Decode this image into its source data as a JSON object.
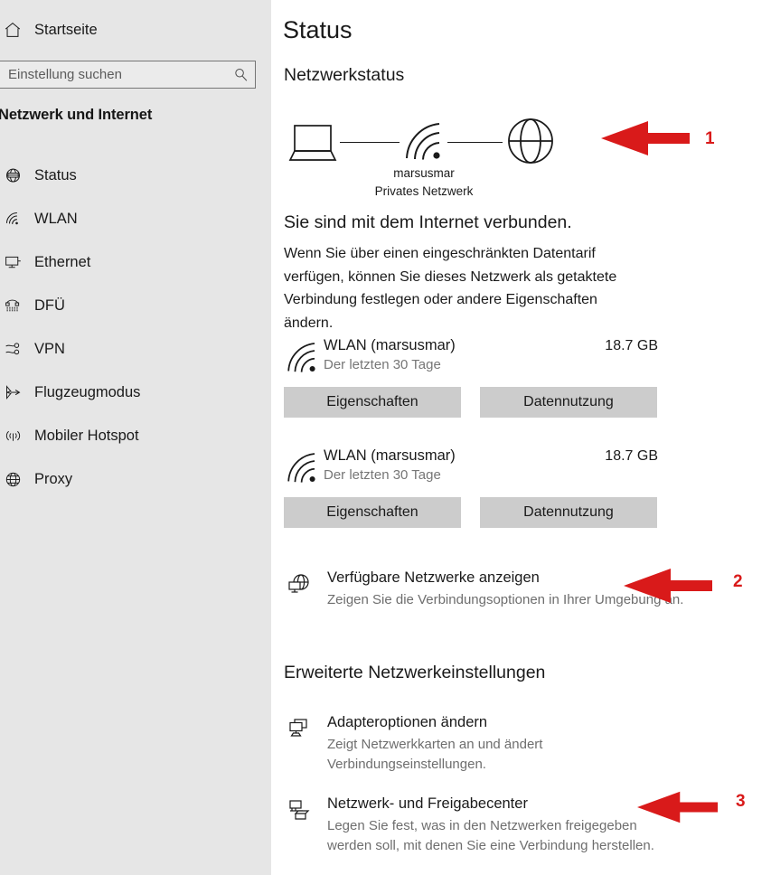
{
  "sidebar": {
    "home": {
      "label": "Startseite",
      "icon": "home-icon"
    },
    "search": {
      "placeholder": "Einstellung suchen",
      "value": "",
      "icon": "search-icon"
    },
    "category_title": "Netzwerk und Internet",
    "items": [
      {
        "label": "Status",
        "icon": "globe-status-icon",
        "selected": true
      },
      {
        "label": "WLAN",
        "icon": "wifi-icon",
        "selected": false
      },
      {
        "label": "Ethernet",
        "icon": "monitor-icon",
        "selected": false
      },
      {
        "label": "DFÜ",
        "icon": "dialup-icon",
        "selected": false
      },
      {
        "label": "VPN",
        "icon": "vpn-icon",
        "selected": false
      },
      {
        "label": "Flugzeugmodus",
        "icon": "airplane-icon",
        "selected": false
      },
      {
        "label": "Mobiler Hotspot",
        "icon": "hotspot-icon",
        "selected": false
      },
      {
        "label": "Proxy",
        "icon": "globe-icon",
        "selected": false
      }
    ]
  },
  "main": {
    "page_title": "Status",
    "network_status_heading": "Netzwerkstatus",
    "diagram": {
      "device_icon": "laptop-icon",
      "link_icon": "wifi-icon",
      "internet_icon": "globe-icon",
      "network_name": "marsusmar",
      "network_type": "Privates Netzwerk"
    },
    "connected_title": "Sie sind mit dem Internet verbunden.",
    "connected_description": "Wenn Sie über einen eingeschränkten Datentarif verfügen, können Sie dieses Netzwerk als getaktete Verbindung festlegen oder andere Eigenschaften ändern.",
    "connections": [
      {
        "icon": "wifi-icon",
        "name": "WLAN (marsusmar)",
        "subtitle": "Der letzten 30 Tage",
        "usage": "18.7 GB",
        "properties_label": "Eigenschaften",
        "data_usage_label": "Datennutzung"
      },
      {
        "icon": "wifi-icon",
        "name": "WLAN (marsusmar)",
        "subtitle": "Der letzten 30 Tage",
        "usage": "18.7 GB",
        "properties_label": "Eigenschaften",
        "data_usage_label": "Datennutzung"
      }
    ],
    "available_networks": {
      "icon": "globe-monitor-icon",
      "title": "Verfügbare Netzwerke anzeigen",
      "description": "Zeigen Sie die Verbindungsoptionen in Ihrer Umgebung an."
    },
    "advanced_heading": "Erweiterte Netzwerkeinstellungen",
    "advanced_items": [
      {
        "icon": "adapter-icon",
        "title": "Adapteroptionen ändern",
        "description": "Zeigt Netzwerkkarten an und ändert Verbindungseinstellungen."
      },
      {
        "icon": "sharing-icon",
        "title": "Netzwerk- und Freigabecenter",
        "description": "Legen Sie fest, was in den Netzwerken freigegeben werden soll, mit denen Sie eine Verbindung herstellen."
      }
    ]
  },
  "annotations": {
    "color": "#d91a1a",
    "markers": [
      {
        "number": "1",
        "target": "network-status-diagram"
      },
      {
        "number": "2",
        "target": "available-networks-entry"
      },
      {
        "number": "3",
        "target": "network-sharing-center-entry"
      }
    ]
  },
  "colors": {
    "sidebar_background": "#e6e6e6",
    "content_background": "#ffffff",
    "button_background": "#cccccc",
    "text_primary": "#1a1a1a",
    "text_secondary": "#767676",
    "annotation_red": "#d91a1a"
  }
}
